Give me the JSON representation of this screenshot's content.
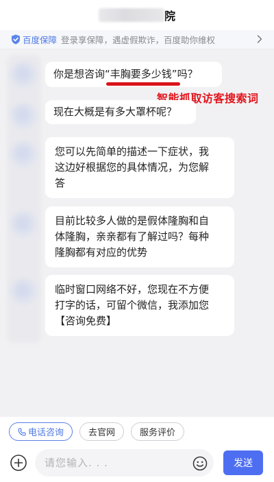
{
  "header": {
    "title_suffix": "院"
  },
  "guarantee": {
    "brand": "百度保障",
    "text": "登录享保障，遇虚假欺诈，百度助你维权",
    "icons": {
      "shield": "shield-check-icon",
      "chevron": "chevron-right-icon"
    }
  },
  "messages": [
    {
      "pre": "你是想咨询",
      "highlight": "“丰胸要多少钱”",
      "post": "吗？"
    },
    {
      "lines": [
        "现在大概是有多大罩杯呢？"
      ]
    },
    {
      "lines": [
        "您可以先简单的描述一下症状，我",
        "这边好根据您的具体情况，为您解",
        "答"
      ]
    },
    {
      "lines": [
        "目前比较多人做的是假体隆胸和自",
        "体隆胸，亲亲都有了解过吗？每种",
        "隆胸都有对应的优势"
      ]
    },
    {
      "lines": [
        "临时窗口网络不好，您现在不方便",
        "打字的话，可留个微信，我添加您",
        "【咨询免费】"
      ]
    }
  ],
  "annotation": "智能抓取访客搜索词",
  "quick_actions": [
    {
      "label": "电话咨询",
      "icon": "phone-icon"
    },
    {
      "label": "去官网"
    },
    {
      "label": "服务评价"
    }
  ],
  "composer": {
    "placeholder": "请您输入. . .",
    "send_label": "发送",
    "icons": {
      "add": "plus-circle-icon",
      "emoji": "emoji-smile-icon"
    }
  },
  "colors": {
    "accent": "#4e6ef2",
    "brand_blue": "#4f79e6",
    "annotation_red": "#e2141c"
  }
}
